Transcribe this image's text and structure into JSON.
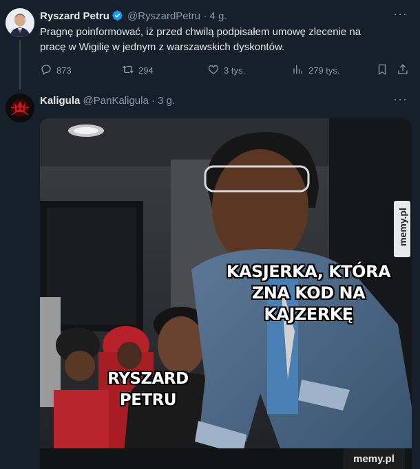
{
  "tweet1": {
    "name": "Ryszard Petru",
    "handle": "@RyszardPetru",
    "time": "· 4 g.",
    "text_line1": "Pragnę poinformować, iż przed chwilą podpisałem umowę zlecenie na",
    "text_line2": "pracę w Wigilię w jednym z warszawskich dyskontów.",
    "replies": "873",
    "retweets": "294",
    "likes": "3 tys.",
    "views": "279 tys."
  },
  "tweet2": {
    "name": "Kaligula",
    "handle": "@PanKaligula",
    "time": "· 3 g.",
    "meme_caption_top_line1": "KASJERKA, KTÓRA",
    "meme_caption_top_line2": "ZNA KOD NA KAJZERKĘ",
    "meme_caption_bottom": "RYSZARD PETRU"
  },
  "watermark": {
    "side": "memy.pl",
    "bottom": "memy.pl"
  },
  "colors": {
    "background": "#15202b",
    "verified": "#1d9bf0",
    "muted": "#8b98a5"
  },
  "icons": [
    "verified-badge-icon",
    "more-icon",
    "reply-icon",
    "retweet-icon",
    "like-icon",
    "views-icon",
    "bookmark-icon",
    "share-icon"
  ]
}
